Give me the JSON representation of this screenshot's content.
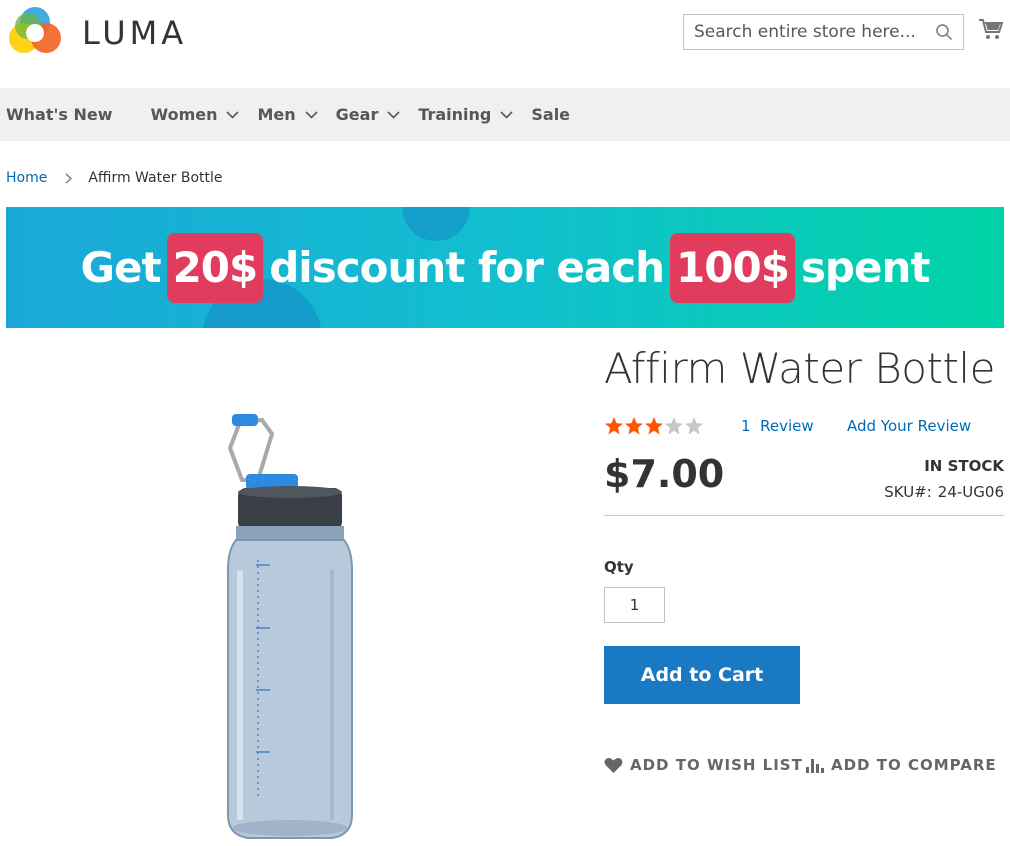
{
  "header": {
    "logo_text": "LUMA",
    "search_placeholder": "Search entire store here...",
    "search_icon": "search-icon",
    "cart_icon": "cart-icon"
  },
  "nav": {
    "items": [
      {
        "label": "What's New",
        "has_dropdown": false
      },
      {
        "label": "Women",
        "has_dropdown": true
      },
      {
        "label": "Men",
        "has_dropdown": true
      },
      {
        "label": "Gear",
        "has_dropdown": true
      },
      {
        "label": "Training",
        "has_dropdown": true
      },
      {
        "label": "Sale",
        "has_dropdown": false
      }
    ]
  },
  "breadcrumb": {
    "home": "Home",
    "current": "Affirm Water Bottle"
  },
  "banner": {
    "part1": "Get",
    "highlight1": "20$",
    "part2": "discount for each",
    "highlight2": "100$",
    "part3": "spent",
    "highlight_color": "#e13c5e"
  },
  "product": {
    "title": "Affirm Water Bottle",
    "rating_filled": 3,
    "rating_max": 5,
    "reviews_count": "1",
    "reviews_label": "Review",
    "add_review_label": "Add Your Review",
    "price": "$7.00",
    "stock": "IN STOCK",
    "sku_label": "SKU#:",
    "sku_value": "24-UG06",
    "qty_label": "Qty",
    "qty_value": "1",
    "add_to_cart_label": "Add to Cart",
    "wishlist_label": "ADD TO WISH LIST",
    "compare_label": "ADD TO COMPARE"
  },
  "colors": {
    "link": "#006bb4",
    "primary_button": "#1979c3",
    "star_filled": "#ff5501",
    "star_empty": "#c7c7c7",
    "nav_bg": "#f0f0f0"
  }
}
